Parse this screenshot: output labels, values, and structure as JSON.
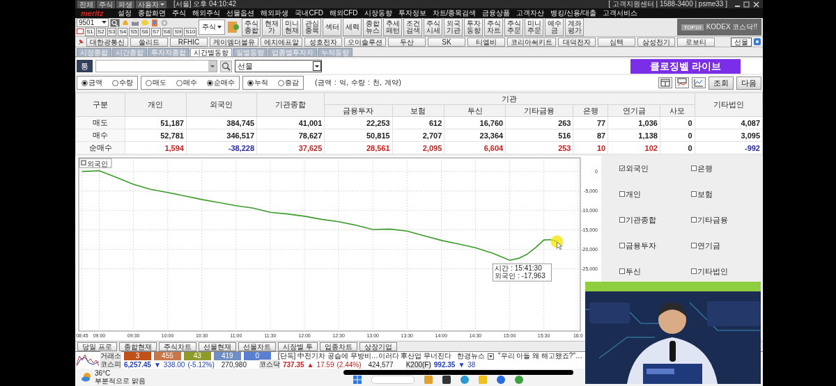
{
  "title_bar": {
    "menus": [
      {
        "label": "전체",
        "kind": "button"
      },
      {
        "label": "주식",
        "kind": "button"
      },
      {
        "label": "파생",
        "kind": "button"
      },
      {
        "label": "사용자",
        "kind": "dropdown"
      }
    ],
    "clock": "[서울] 오후 04:10:42",
    "support": "[ 고객지원센터 | 1588-3400 | psme33 ]"
  },
  "menu_bar": {
    "logo": "meritz",
    "items": [
      "설정",
      "종합화면",
      "주식",
      "해외주식",
      "선물옵션",
      "해외파생",
      "국내CFD",
      "해외CFD",
      "시장동향",
      "투자정보",
      "차트/종목검색",
      "금융상품",
      "고객자산",
      "뱅킹/신용/대출",
      "고객서비스"
    ]
  },
  "toolbar": {
    "code": "9501",
    "slots": [
      "S1",
      "S2",
      "S3",
      "S4",
      "S5",
      "S6",
      "S7",
      "S8",
      "S9",
      "S10"
    ],
    "category": "주식",
    "buttons": [
      "주식종합",
      "현재가",
      "미니현재",
      "관심종목",
      "섹터",
      "세력",
      "종합뉴스",
      "추세패턴",
      "조건검색",
      "주식시세",
      "외국기관",
      "투자동향",
      "주식차트",
      "주식주문",
      "미니주문",
      "예수금",
      "계좌평가"
    ],
    "ad": {
      "badge": "TOP10",
      "text": "KODEX 코스닥!!"
    }
  },
  "favorites": {
    "items": [
      "대한광통신",
      "쏠리드",
      "RFHIC",
      "케이엠더블유",
      "에치에프알",
      "성호전자",
      "오이솔루션",
      "두산",
      "SK",
      "티엘비",
      "코리아써키트",
      "대덕전자",
      "심텍",
      "삼성전기",
      "로보티"
    ],
    "futures_button": "선물"
  },
  "tabs": [
    {
      "label": "시장종합",
      "selected": false
    },
    {
      "label": "시간종합",
      "selected": false
    },
    {
      "label": "투자자종합",
      "selected": false
    },
    {
      "label": "시간별동향",
      "selected": true
    },
    {
      "label": "일별동향",
      "selected": false
    },
    {
      "label": "업종별투자자",
      "selected": false
    },
    {
      "label": "누적동향",
      "selected": false
    }
  ],
  "search": {
    "type_button": "통",
    "market": "선물"
  },
  "banner": "클로징벨 라이브",
  "radio_groups": [
    {
      "options": [
        {
          "label": "금액",
          "selected": true
        },
        {
          "label": "수량",
          "selected": false
        }
      ]
    },
    {
      "options": [
        {
          "label": "매도",
          "selected": false
        },
        {
          "label": "매수",
          "selected": false
        },
        {
          "label": "순매수",
          "selected": true
        }
      ]
    },
    {
      "options": [
        {
          "label": "누적",
          "selected": true
        },
        {
          "label": "증감",
          "selected": false
        }
      ]
    }
  ],
  "unit_note": "(금액 : 억, 수량 : 천, 계약)",
  "buttons": [
    "조회",
    "다음"
  ],
  "table": {
    "columns": [
      {
        "label": "구분"
      },
      {
        "label": "개인"
      },
      {
        "label": "외국인"
      },
      {
        "label": "기관종합"
      },
      {
        "label": "기관",
        "colspan": 7,
        "children": [
          "금융투자",
          "보험",
          "투신",
          "기타금융",
          "은행",
          "연기금",
          "사모"
        ]
      },
      {
        "label": "기타법인"
      }
    ],
    "rows": [
      {
        "cells": [
          {
            "text": "매도"
          },
          {
            "text": "51,187"
          },
          {
            "text": "384,745"
          },
          {
            "text": "41,001"
          },
          {
            "text": "22,253"
          },
          {
            "text": "612"
          },
          {
            "text": "16,760"
          },
          {
            "text": "263"
          },
          {
            "text": "77"
          },
          {
            "text": "1,036"
          },
          {
            "text": "0"
          },
          {
            "text": "4,087"
          }
        ]
      },
      {
        "cells": [
          {
            "text": "매수"
          },
          {
            "text": "52,781"
          },
          {
            "text": "346,517"
          },
          {
            "text": "78,627"
          },
          {
            "text": "50,815"
          },
          {
            "text": "2,707"
          },
          {
            "text": "23,364"
          },
          {
            "text": "516"
          },
          {
            "text": "87"
          },
          {
            "text": "1,138"
          },
          {
            "text": "0"
          },
          {
            "text": "3,095"
          }
        ]
      },
      {
        "cells": [
          {
            "text": "순매수"
          },
          {
            "text": "1,594",
            "color": "#c81e1e"
          },
          {
            "text": "-38,228",
            "color": "#2a2aa8"
          },
          {
            "text": "37,625",
            "color": "#c81e1e"
          },
          {
            "text": "28,561",
            "color": "#c81e1e"
          },
          {
            "text": "2,095",
            "color": "#c81e1e"
          },
          {
            "text": "6,604",
            "color": "#c81e1e"
          },
          {
            "text": "253",
            "color": "#c81e1e"
          },
          {
            "text": "10",
            "color": "#c81e1e"
          },
          {
            "text": "102",
            "color": "#c81e1e"
          },
          {
            "text": "0"
          },
          {
            "text": "-992",
            "color": "#2a2aa8"
          }
        ]
      }
    ]
  },
  "chart": {
    "tooltip": [
      "시간 : 15:41:30",
      "외국인 : -17,963"
    ],
    "chart_data": {
      "type": "line",
      "grid": true,
      "xlim": [
        522,
        962
      ],
      "ylim": [
        -41000,
        3500
      ],
      "xticks": [
        {
          "value": 525,
          "label": "08:45"
        },
        {
          "value": 540,
          "label": "09:00"
        },
        {
          "value": 570,
          "label": "09:30"
        },
        {
          "value": 600,
          "label": "10:00"
        },
        {
          "value": 630,
          "label": "10:30"
        },
        {
          "value": 660,
          "label": "11:00"
        },
        {
          "value": 690,
          "label": "11:30"
        },
        {
          "value": 720,
          "label": "12:00"
        },
        {
          "value": 750,
          "label": "12:30"
        },
        {
          "value": 780,
          "label": "13:00"
        },
        {
          "value": 810,
          "label": "13:30"
        },
        {
          "value": 840,
          "label": "14:00"
        },
        {
          "value": 870,
          "label": "14:30"
        },
        {
          "value": 900,
          "label": "15:00"
        },
        {
          "value": 930,
          "label": "15:30"
        },
        {
          "value": 960,
          "label": "16:0"
        }
      ],
      "yticks": [
        0,
        {
          "value": -5000,
          "label": "-5,000"
        },
        {
          "value": -10000,
          "label": "-10,000"
        },
        {
          "value": -15000,
          "label": "-15,000"
        },
        {
          "value": -20000,
          "label": "-20,000"
        },
        {
          "value": -25000,
          "label": "-25,000"
        }
      ],
      "x": [
        525,
        540,
        555,
        570,
        585,
        600,
        615,
        630,
        645,
        660,
        675,
        690,
        705,
        720,
        735,
        750,
        765,
        780,
        795,
        810,
        825,
        840,
        855,
        870,
        885,
        900,
        908,
        915,
        923,
        930,
        936,
        941.5
      ],
      "series": [
        {
          "name": "외국인",
          "color": "#3a9a2a",
          "values": [
            0,
            200,
            -1500,
            -3300,
            -4600,
            -5400,
            -6300,
            -7200,
            -8000,
            -8800,
            -9400,
            -10500,
            -10900,
            -11500,
            -12300,
            -12900,
            -13800,
            -14900,
            -14800,
            -15300,
            -16500,
            -17700,
            -18600,
            -19600,
            -21000,
            -22800,
            -22300,
            -21300,
            -19500,
            -17600,
            -17500,
            -18000
          ]
        }
      ]
    }
  },
  "series_checks": [
    {
      "label": "외국인",
      "checked": true
    },
    {
      "label": "은행",
      "checked": false
    },
    {
      "label": "개인",
      "checked": false
    },
    {
      "label": "보험",
      "checked": false
    },
    {
      "label": "기관종합",
      "checked": false
    },
    {
      "label": "기타금융",
      "checked": false
    },
    {
      "label": "금융투자",
      "checked": false
    },
    {
      "label": "연기금",
      "checked": false
    },
    {
      "label": "투신",
      "checked": false
    },
    {
      "label": "기타법인",
      "checked": false
    }
  ],
  "bottom_tabs": [
    "당일 프로",
    "종합현재",
    "주식차트",
    "선물현재",
    "선물차트",
    "시장별 투",
    "업종차트",
    "상장기업"
  ],
  "ticker": {
    "breadth_label": "거래소",
    "breadth": [
      {
        "value": "3",
        "color": "#c0501a"
      },
      {
        "value": "455",
        "color": "#c8764a"
      },
      {
        "value": "43",
        "color": "#8e9a2e"
      },
      {
        "value": "419",
        "color": "#6f8ec4"
      },
      {
        "value": "0",
        "color": "#5a7fd0"
      }
    ],
    "news": {
      "headline": "[단독] 中전기차 공습에 무방비…이러다 車산업 무너진다",
      "source": "한경뉴스"
    },
    "news_2": "\"우리 아들 왜 해고됐죠?\"…",
    "indices": [
      {
        "name": "코스피",
        "value": "6,257.45",
        "arrow": "▼",
        "change": "338.00",
        "rate": "(-5.12%)",
        "volume": "270,980",
        "color": "#2040c0"
      },
      {
        "name": "코스닥",
        "value": "737.35",
        "arrow": "▲",
        "change": "17.59",
        "rate": "(2.44%)",
        "volume": "424,577",
        "color": "#c82020"
      },
      {
        "name": "K200(F)",
        "value": "992.35",
        "arrow": "▼",
        "change": "38",
        "color": "#2040c0"
      }
    ]
  },
  "taskbar": {
    "temperature": "36°C",
    "weather": "부분적으로 맑음"
  }
}
